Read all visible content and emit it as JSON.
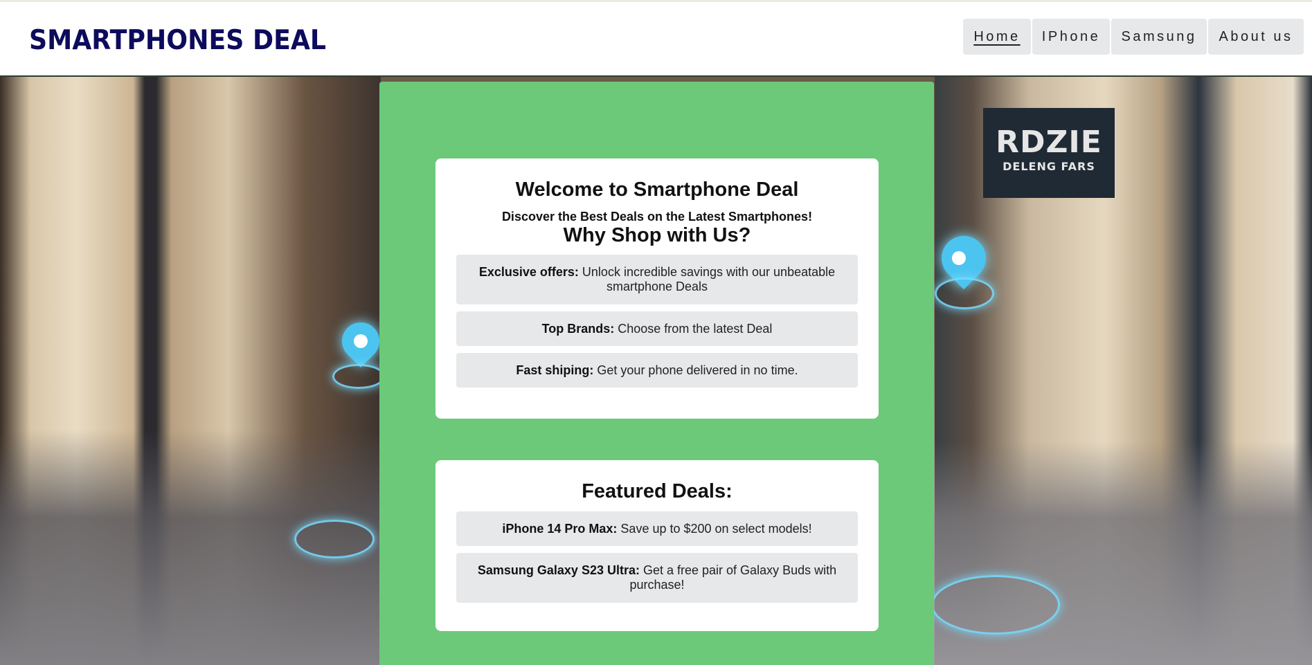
{
  "header": {
    "logo": "SMARTPHONES DEAL",
    "nav": [
      {
        "label": "Home",
        "active": true
      },
      {
        "label": "IPhone",
        "active": false
      },
      {
        "label": "Samsung",
        "active": false
      },
      {
        "label": "About us",
        "active": false
      }
    ]
  },
  "background": {
    "store_sign_main": "RDZIE",
    "store_sign_sub": "DELENG FARS"
  },
  "welcome": {
    "title": "Welcome to Smartphone Deal",
    "subtitle": "Discover the Best Deals on the Latest Smartphones!",
    "why_title": "Why Shop with Us?",
    "features": [
      {
        "label": "Exclusive offers:",
        "text": "Unlock incredible savings with our unbeatable smartphone Deals"
      },
      {
        "label": "Top Brands:",
        "text": "Choose from the latest Deal"
      },
      {
        "label": "Fast shiping:",
        "text": "Get your phone delivered in no time."
      }
    ]
  },
  "featured": {
    "title": "Featured Deals:",
    "deals": [
      {
        "label": "iPhone 14 Pro Max:",
        "text": "Save up to $200 on select models!"
      },
      {
        "label": "Samsung Galaxy S23 Ultra:",
        "text": "Get a free pair of Galaxy Buds with purchase!"
      }
    ]
  },
  "colors": {
    "logo": "#0d0b5c",
    "panel_green": "#6cc979",
    "nav_bg": "#e6e8ea",
    "feature_bg": "#e6e8ea"
  }
}
